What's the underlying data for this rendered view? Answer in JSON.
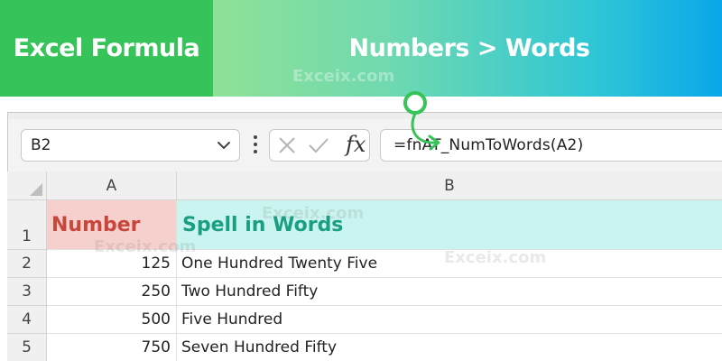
{
  "banner": {
    "left_title": "Excel Formula",
    "right_title": "Numbers > Words",
    "watermark": "Exceix.com"
  },
  "formula_bar": {
    "name_box": "B2",
    "fx_label": "fx",
    "formula": "=fnAT_NumToWords(A2)",
    "icons": [
      "chevron-down-icon",
      "more-vertical-icon",
      "cancel-icon",
      "enter-check-icon",
      "fx-icon"
    ]
  },
  "sheet": {
    "columns": [
      "A",
      "B"
    ],
    "row_numbers": [
      "1",
      "2",
      "3",
      "4",
      "5"
    ],
    "header_row": {
      "a": "Number",
      "b": "Spell in Words"
    },
    "rows": [
      {
        "number": "125",
        "words": "One Hundred Twenty Five"
      },
      {
        "number": "250",
        "words": "Two Hundred Fifty"
      },
      {
        "number": "500",
        "words": "Five Hundred"
      },
      {
        "number": "750",
        "words": "Seven Hundred Fifty"
      }
    ],
    "watermark": "Exceix.com"
  },
  "colors": {
    "banner_left": "#35c35a",
    "banner_right_start": "#8fe196",
    "banner_right_end": "#0aa7ea",
    "header_a_fill": "#f6d0cc",
    "header_a_text": "#c9463d",
    "header_b_fill": "#c9f4ef",
    "header_b_text": "#1a9f83",
    "annotation_arrow": "#35c35a"
  }
}
